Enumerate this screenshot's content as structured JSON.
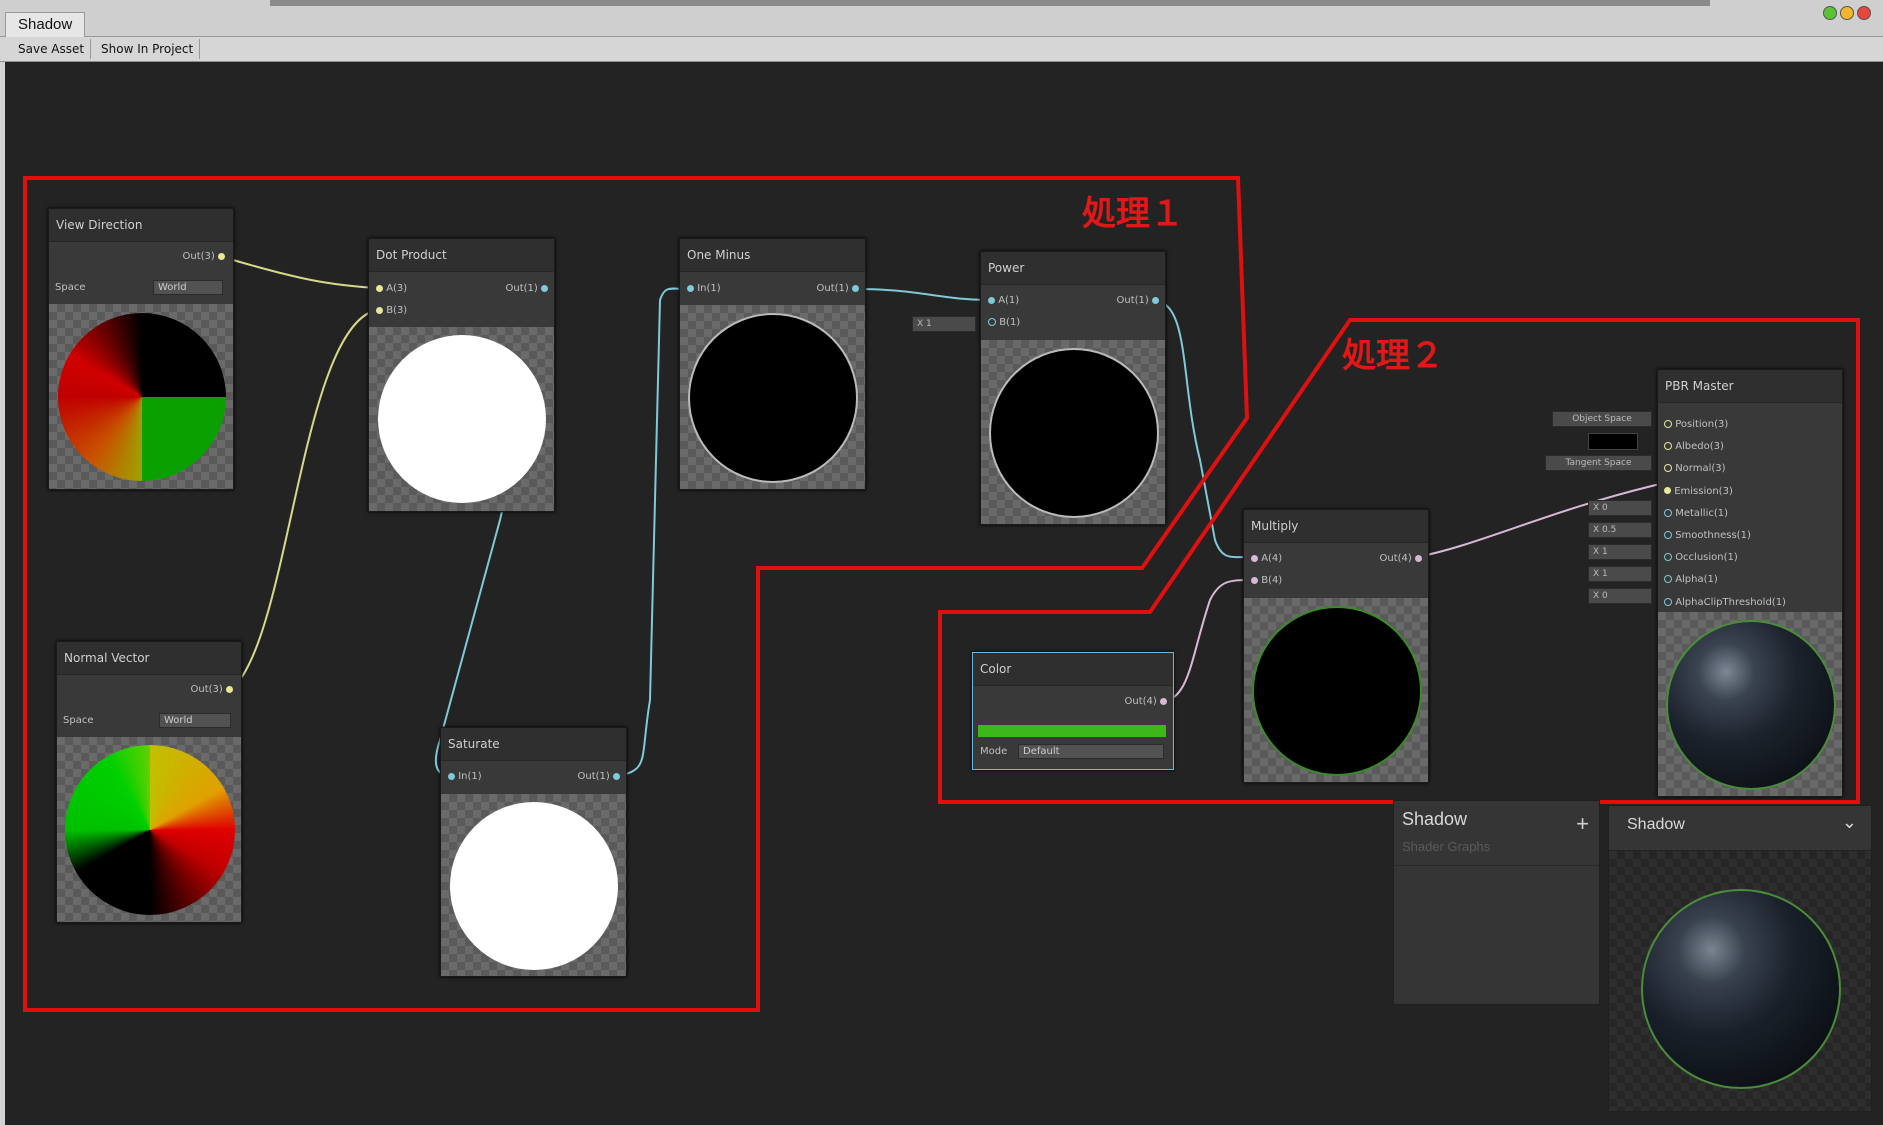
{
  "window": {
    "tab_title": "Shadow"
  },
  "toolbar": {
    "save_asset": "Save Asset",
    "show_in_project": "Show In Project"
  },
  "annotations": {
    "group1": "処理１",
    "group2": "処理２"
  },
  "nodes": {
    "view_direction": {
      "title": "View Direction",
      "out": "Out(3)",
      "space_label": "Space",
      "space_value": "World"
    },
    "normal_vector": {
      "title": "Normal Vector",
      "out": "Out(3)",
      "space_label": "Space",
      "space_value": "World"
    },
    "dot_product": {
      "title": "Dot Product",
      "in_a": "A(3)",
      "in_b": "B(3)",
      "out": "Out(1)"
    },
    "saturate": {
      "title": "Saturate",
      "in": "In(1)",
      "out": "Out(1)"
    },
    "one_minus": {
      "title": "One Minus",
      "in": "In(1)",
      "out": "Out(1)"
    },
    "power": {
      "title": "Power",
      "in_a": "A(1)",
      "in_b": "B(1)",
      "out": "Out(1)",
      "b_default": "X 1"
    },
    "multiply": {
      "title": "Multiply",
      "in_a": "A(4)",
      "in_b": "B(4)",
      "out": "Out(4)"
    },
    "color": {
      "title": "Color",
      "out": "Out(4)",
      "mode_label": "Mode",
      "mode_value": "Default",
      "swatch": "#3cb81a"
    },
    "pbr_master": {
      "title": "PBR Master",
      "inputs": [
        "Position(3)",
        "Albedo(3)",
        "Normal(3)",
        "Emission(3)",
        "Metallic(1)",
        "Smoothness(1)",
        "Occlusion(1)",
        "Alpha(1)",
        "AlphaClipThreshold(1)"
      ],
      "defaults": {
        "position": "Object Space",
        "normal": "Tangent Space",
        "metallic": "X 0",
        "smoothness": "X 0.5",
        "occlusion": "X 1",
        "alpha": "X 1",
        "alpha_clip": "X 0"
      }
    }
  },
  "blackboard": {
    "title": "Shadow",
    "subtitle": "Shader Graphs",
    "add": "+"
  },
  "main_preview": {
    "title": "Shadow",
    "chevron": "⌄"
  }
}
